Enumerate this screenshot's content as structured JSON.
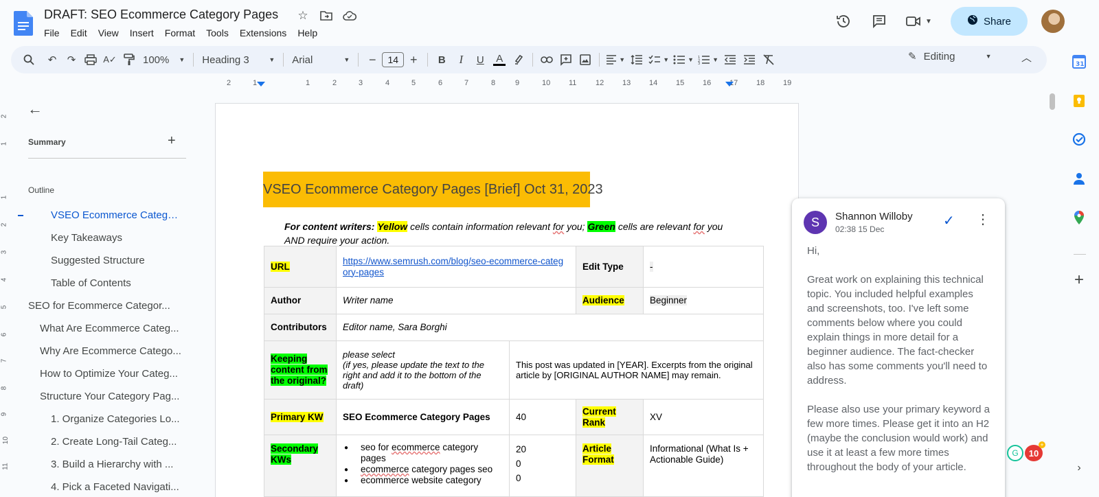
{
  "header": {
    "title": "DRAFT: SEO Ecommerce Category Pages",
    "menu": [
      "File",
      "Edit",
      "View",
      "Insert",
      "Format",
      "Tools",
      "Extensions",
      "Help"
    ],
    "share_label": "Share"
  },
  "toolbar": {
    "zoom": "100%",
    "style": "Heading 3",
    "font": "Arial",
    "font_size": "14",
    "mode": "Editing"
  },
  "ruler": [
    "2",
    "1",
    "1",
    "2",
    "3",
    "4",
    "5",
    "6",
    "7",
    "8",
    "9",
    "10",
    "11",
    "12",
    "13",
    "14",
    "15",
    "16",
    "17",
    "18",
    "19"
  ],
  "vruler": [
    "2",
    "1",
    "1",
    "2",
    "3",
    "4",
    "5",
    "6",
    "7",
    "8",
    "9",
    "10",
    "11"
  ],
  "sidebar": {
    "summary_label": "Summary",
    "outline_label": "Outline",
    "items": [
      {
        "label": "VSEO Ecommerce Catego..."
      },
      {
        "label": "Key Takeaways"
      },
      {
        "label": "Suggested Structure"
      },
      {
        "label": "Table of Contents"
      },
      {
        "label": "SEO for Ecommerce Categor..."
      },
      {
        "label": "What Are Ecommerce Categ..."
      },
      {
        "label": "Why Are Ecommerce Catego..."
      },
      {
        "label": "How to Optimize Your Categ..."
      },
      {
        "label": "Structure Your Category Pag..."
      },
      {
        "label": "1. Organize Categories Lo..."
      },
      {
        "label": "2. Create Long-Tail Categ..."
      },
      {
        "label": "3. Build a Hierarchy with ..."
      },
      {
        "label": "4. Pick a Faceted Navigati..."
      }
    ]
  },
  "doc": {
    "heading": "VSEO Ecommerce Category Pages [Brief]  Oct 31, 2023",
    "intro": {
      "lead": "For content writers:",
      "yellow": "Yellow",
      "part1": "cells contain information relevant",
      "for_word": "for",
      "part2": "you;",
      "green": "Green",
      "part3": "cells are relevant",
      "part4": "you AND require your action."
    },
    "table": {
      "url_label": "URL",
      "url_line1": "https://www.semrush.com/blog/seo-ecommerce-categ",
      "url_line2": "ory-pages",
      "edit_type_label": "Edit Type",
      "edit_type_value": "-",
      "author_label": "Author",
      "author_value": "Writer name",
      "audience_label": "Audience",
      "audience_value": "Beginner",
      "contributors_label": "Contributors",
      "contributors_value": "Editor name, Sara Borghi",
      "keeping_label": "Keeping content from the original?",
      "keeping_select": "please select",
      "keeping_note": "(if yes, please update the text to the right and add it to the bottom of the draft)",
      "keeping_text": "This post was updated in [YEAR]. Excerpts from the original article by [ORIGINAL AUTHOR NAME] may remain.",
      "primary_label": "Primary KW",
      "primary_value": "SEO Ecommerce Category Pages",
      "primary_volume": "40",
      "rank_label": "Current Rank",
      "rank_value": "XV",
      "secondary_label": "Secondary KWs",
      "secondary": [
        {
          "pre": "seo for",
          "kw": "ecommerce",
          "post": "category pages"
        },
        {
          "pre": "",
          "kw": "ecommerce",
          "post": "category pages seo"
        },
        {
          "pre": "",
          "kw": "",
          "post": "ecommerce website category"
        }
      ],
      "secondary_volumes": [
        "20",
        "0",
        "0"
      ],
      "format_label": "Article Format",
      "format_value": "Informational (What Is + Actionable Guide)"
    }
  },
  "comment": {
    "avatar_letter": "S",
    "author": "Shannon Willoby",
    "time": "02:38 15 Dec",
    "greeting": "Hi,",
    "para1": "Great work on explaining this technical topic. You included helpful examples and screenshots, too. I've left some comments below where you could explain things in more detail for a beginner audience. The fact-checker also has some comments you'll need to address.",
    "para2": "Please also use your primary keyword a few more times. Please get it into an H2 (maybe the conclusion would work) and use it at least a few more times throughout the body of your article."
  },
  "badge": {
    "count": "10"
  },
  "colors": {
    "heading_bg": "#fbbc04",
    "highlight_yellow": "#ffff00",
    "highlight_green": "#00ff00",
    "share_bg": "#c2e7ff",
    "accent": "#0b57d0"
  }
}
